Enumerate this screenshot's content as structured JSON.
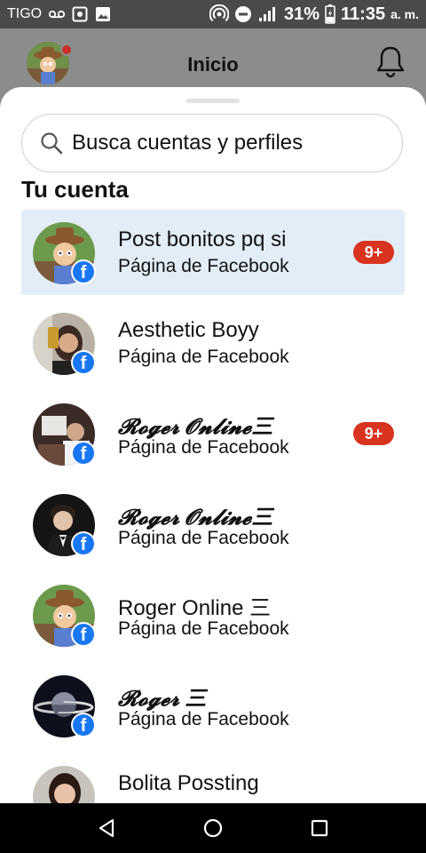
{
  "status_bar": {
    "carrier": "TIGO",
    "battery_percent": "31%",
    "time": "11:35",
    "ampm": "a. m."
  },
  "header": {
    "title": "Inicio",
    "notification_dot_color": "#c8312a"
  },
  "search": {
    "placeholder": "Busca cuentas y perfiles"
  },
  "section": {
    "title": "Tu cuenta"
  },
  "accounts": [
    {
      "name": "Post bonitos pq si",
      "subtitle": "Página de Facebook",
      "badge": "9+",
      "selected": true
    },
    {
      "name": "Aesthetic Boyy",
      "subtitle": "Página de Facebook",
      "badge": "",
      "selected": false
    },
    {
      "name": "𝓡𝓸𝓰𝓮𝓻 𝓞𝓷𝓵𝓲𝓷𝓮三",
      "subtitle": "Página de Facebook",
      "badge": "9+",
      "selected": false
    },
    {
      "name": "𝓡𝓸𝓰𝓮𝓻 𝓞𝓷𝓵𝓲𝓷𝓮三",
      "subtitle": "Página de Facebook",
      "badge": "",
      "selected": false
    },
    {
      "name": "Roger Online 三",
      "subtitle": "Página de Facebook",
      "badge": "",
      "selected": false
    },
    {
      "name": "𝓡𝓸𝓰𝓮𝓻 三",
      "subtitle": "Página de Facebook",
      "badge": "",
      "selected": false
    },
    {
      "name": "Bolita Possting",
      "subtitle": "",
      "badge": "",
      "selected": false
    }
  ],
  "colors": {
    "facebook_blue": "#1877f2",
    "badge_red": "#d8331f",
    "selected_row": "#e3edf8"
  },
  "icons": {
    "search": "search-icon",
    "bell": "bell-icon",
    "facebook": "facebook-icon",
    "nav_back": "back-triangle-icon",
    "nav_home": "home-circle-icon",
    "nav_recents": "recents-square-icon"
  }
}
